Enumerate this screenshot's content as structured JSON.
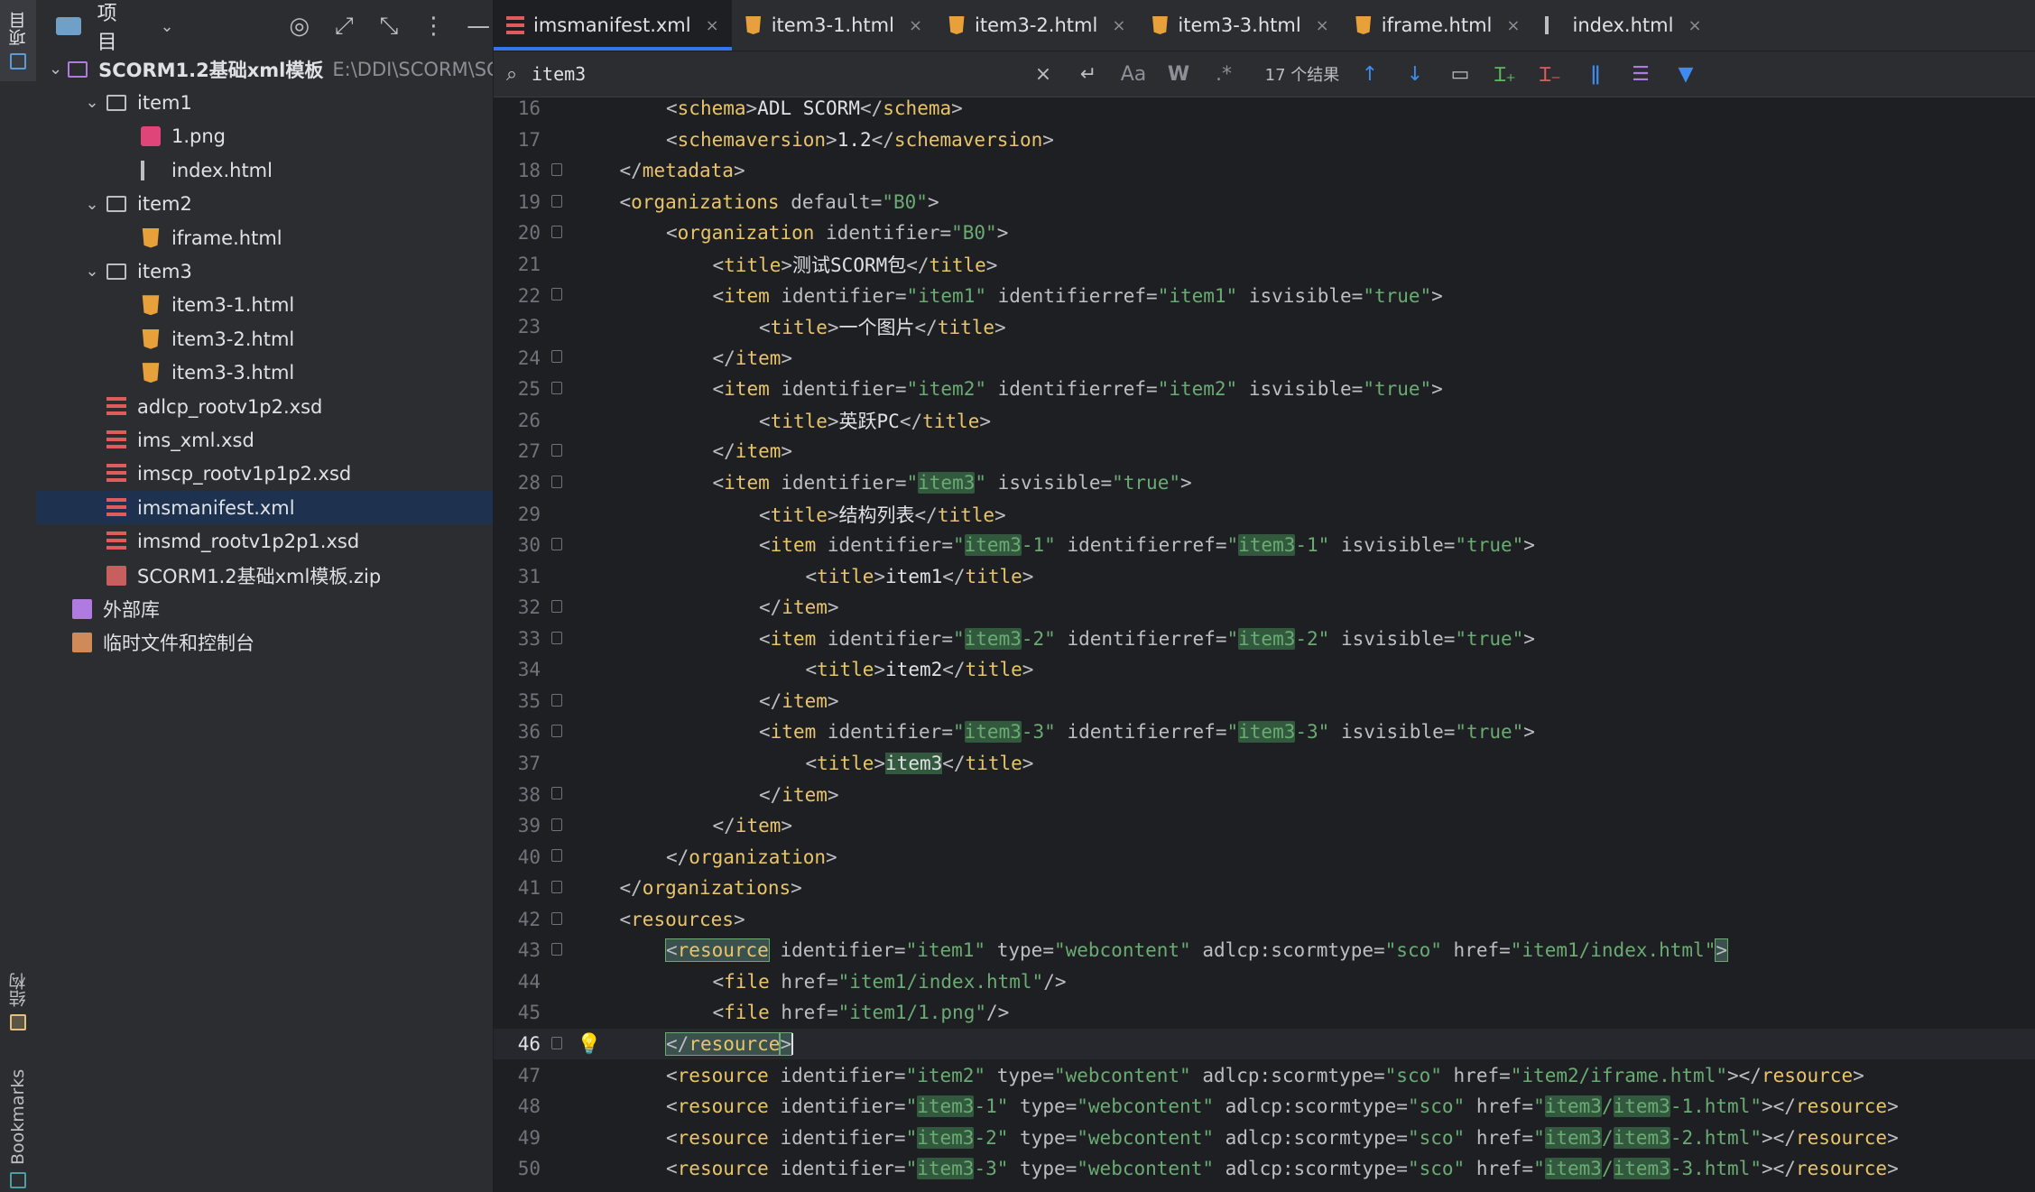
{
  "sidebar_stripe": {
    "project_label": "项目",
    "structure_label": "结构",
    "bookmarks_label": "Bookmarks"
  },
  "project_panel": {
    "title": "项目",
    "root_name": "SCORM1.2基础xml模板",
    "root_path": "E:\\DDI\\SCORM\\SC",
    "tree": [
      {
        "label": "SCORM1.2基础xml模板",
        "icon": "folder-purple",
        "depth": 0,
        "expanded": true
      },
      {
        "label": "item1",
        "icon": "folder",
        "depth": 1,
        "expanded": true
      },
      {
        "label": "1.png",
        "icon": "png",
        "depth": 2
      },
      {
        "label": "index.html",
        "icon": "html-index",
        "depth": 2
      },
      {
        "label": "item2",
        "icon": "folder",
        "depth": 1,
        "expanded": true
      },
      {
        "label": "iframe.html",
        "icon": "html5",
        "depth": 2
      },
      {
        "label": "item3",
        "icon": "folder",
        "depth": 1,
        "expanded": true
      },
      {
        "label": "item3-1.html",
        "icon": "html5",
        "depth": 2
      },
      {
        "label": "item3-2.html",
        "icon": "html5",
        "depth": 2
      },
      {
        "label": "item3-3.html",
        "icon": "html5",
        "depth": 2
      },
      {
        "label": "adlcp_rootv1p2.xsd",
        "icon": "xsd",
        "depth": 1
      },
      {
        "label": "ims_xml.xsd",
        "icon": "xsd",
        "depth": 1
      },
      {
        "label": "imscp_rootv1p1p2.xsd",
        "icon": "xsd",
        "depth": 1
      },
      {
        "label": "imsmanifest.xml",
        "icon": "xsd",
        "depth": 1,
        "selected": true
      },
      {
        "label": "imsmd_rootv1p2p1.xsd",
        "icon": "xsd",
        "depth": 1
      },
      {
        "label": "SCORM1.2基础xml模板.zip",
        "icon": "zip",
        "depth": 1
      },
      {
        "label": "外部库",
        "icon": "lib",
        "depth": 0
      },
      {
        "label": "临时文件和控制台",
        "icon": "scratch",
        "depth": 0
      }
    ]
  },
  "tabs": [
    {
      "label": "imsmanifest.xml",
      "icon": "xml-icon",
      "active": true
    },
    {
      "label": "item3-1.html",
      "icon": "html5-icon"
    },
    {
      "label": "item3-2.html",
      "icon": "html5-icon"
    },
    {
      "label": "item3-3.html",
      "icon": "html5-icon"
    },
    {
      "label": "iframe.html",
      "icon": "html5-icon"
    },
    {
      "label": "index.html",
      "icon": "html-index-icon"
    }
  ],
  "search": {
    "query": "item3",
    "match_count": "17 个结果",
    "case_label": "Aa",
    "word_label": "W",
    "regex_label": ".*"
  },
  "colors": {
    "accent": "#3574f0",
    "tag": "#e8c46a",
    "value": "#6aab73",
    "match_bg": "#32593d"
  },
  "editor": {
    "current_line": 46,
    "lines": [
      {
        "n": 16,
        "indent": 2,
        "code": "<schema>ADL SCORM</schema>"
      },
      {
        "n": 17,
        "indent": 2,
        "code": "<schemaversion>1.2</schemaversion>"
      },
      {
        "n": 18,
        "indent": 1,
        "code": "</metadata>",
        "fold": true
      },
      {
        "n": 19,
        "indent": 1,
        "code": "<organizations default=\"B0\">",
        "fold": true
      },
      {
        "n": 20,
        "indent": 2,
        "code": "<organization identifier=\"B0\">",
        "fold": true
      },
      {
        "n": 21,
        "indent": 3,
        "code": "<title>测试SCORM包</title>"
      },
      {
        "n": 22,
        "indent": 3,
        "code": "<item identifier=\"item1\" identifierref=\"item1\" isvisible=\"true\">",
        "fold": true
      },
      {
        "n": 23,
        "indent": 4,
        "code": "<title>一个图片</title>"
      },
      {
        "n": 24,
        "indent": 3,
        "code": "</item>",
        "fold": true
      },
      {
        "n": 25,
        "indent": 3,
        "code": "<item identifier=\"item2\" identifierref=\"item2\" isvisible=\"true\">",
        "fold": true
      },
      {
        "n": 26,
        "indent": 4,
        "code": "<title>英跃PC</title>"
      },
      {
        "n": 27,
        "indent": 3,
        "code": "</item>",
        "fold": true
      },
      {
        "n": 28,
        "indent": 3,
        "code": "<item identifier=\"item3\" isvisible=\"true\">",
        "fold": true
      },
      {
        "n": 29,
        "indent": 4,
        "code": "<title>结构列表</title>"
      },
      {
        "n": 30,
        "indent": 4,
        "code": "<item identifier=\"item3-1\" identifierref=\"item3-1\" isvisible=\"true\">",
        "fold": true
      },
      {
        "n": 31,
        "indent": 5,
        "code": "<title>item1</title>"
      },
      {
        "n": 32,
        "indent": 4,
        "code": "</item>",
        "fold": true
      },
      {
        "n": 33,
        "indent": 4,
        "code": "<item identifier=\"item3-2\" identifierref=\"item3-2\" isvisible=\"true\">",
        "fold": true
      },
      {
        "n": 34,
        "indent": 5,
        "code": "<title>item2</title>"
      },
      {
        "n": 35,
        "indent": 4,
        "code": "</item>",
        "fold": true
      },
      {
        "n": 36,
        "indent": 4,
        "code": "<item identifier=\"item3-3\" identifierref=\"item3-3\" isvisible=\"true\">",
        "fold": true
      },
      {
        "n": 37,
        "indent": 5,
        "code": "<title>item3</title>"
      },
      {
        "n": 38,
        "indent": 4,
        "code": "</item>",
        "fold": true
      },
      {
        "n": 39,
        "indent": 3,
        "code": "</item>",
        "fold": true
      },
      {
        "n": 40,
        "indent": 2,
        "code": "</organization>",
        "fold": true
      },
      {
        "n": 41,
        "indent": 1,
        "code": "</organizations>",
        "fold": true
      },
      {
        "n": 42,
        "indent": 1,
        "code": "<resources>",
        "fold": true
      },
      {
        "n": 43,
        "indent": 2,
        "code": "<resource identifier=\"item1\" type=\"webcontent\" adlcp:scormtype=\"sco\" href=\"item1/index.html\">",
        "fold": true,
        "tagsel": true
      },
      {
        "n": 44,
        "indent": 3,
        "code": "<file href=\"item1/index.html\"/>"
      },
      {
        "n": 45,
        "indent": 3,
        "code": "<file href=\"item1/1.png\"/>"
      },
      {
        "n": 46,
        "indent": 2,
        "code": "</resource>",
        "fold": true,
        "bulb": true,
        "tagsel": true
      },
      {
        "n": 47,
        "indent": 2,
        "code": "<resource identifier=\"item2\" type=\"webcontent\" adlcp:scormtype=\"sco\" href=\"item2/iframe.html\"></resource>"
      },
      {
        "n": 48,
        "indent": 2,
        "code": "<resource identifier=\"item3-1\" type=\"webcontent\" adlcp:scormtype=\"sco\" href=\"item3/item3-1.html\"></resource>"
      },
      {
        "n": 49,
        "indent": 2,
        "code": "<resource identifier=\"item3-2\" type=\"webcontent\" adlcp:scormtype=\"sco\" href=\"item3/item3-2.html\"></resource>"
      },
      {
        "n": 50,
        "indent": 2,
        "code": "<resource identifier=\"item3-3\" type=\"webcontent\" adlcp:scormtype=\"sco\" href=\"item3/item3-3.html\"></resource>"
      }
    ]
  }
}
